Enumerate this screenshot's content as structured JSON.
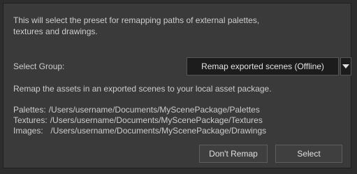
{
  "intro_text": "This will select the preset for remapping paths of external palettes, textures and drawings.",
  "group": {
    "label": "Select Group:",
    "selected": "Remap exported scenes (Offline)",
    "arrow_icon": "chevron-down-icon"
  },
  "remap_description": "Remap the assets in an exported scenes to your local asset package.",
  "paths": [
    {
      "key": "Palettes:",
      "value": "/Users/username/Documents/MyScenePackage/Palettes"
    },
    {
      "key": "Textures:",
      "value": "/Users/username/Documents/MyScenePackage/Textures"
    },
    {
      "key": "Images:",
      "value": "  /Users/username/Documents/MyScenePackage/Drawings"
    }
  ],
  "buttons": {
    "dont_remap": "Don't Remap",
    "select": "Select"
  },
  "colors": {
    "background": "#2d2d2d",
    "panel": "#3a3a3a",
    "text": "#cdcdcd",
    "dropdown_bg": "#1c1c1c"
  }
}
